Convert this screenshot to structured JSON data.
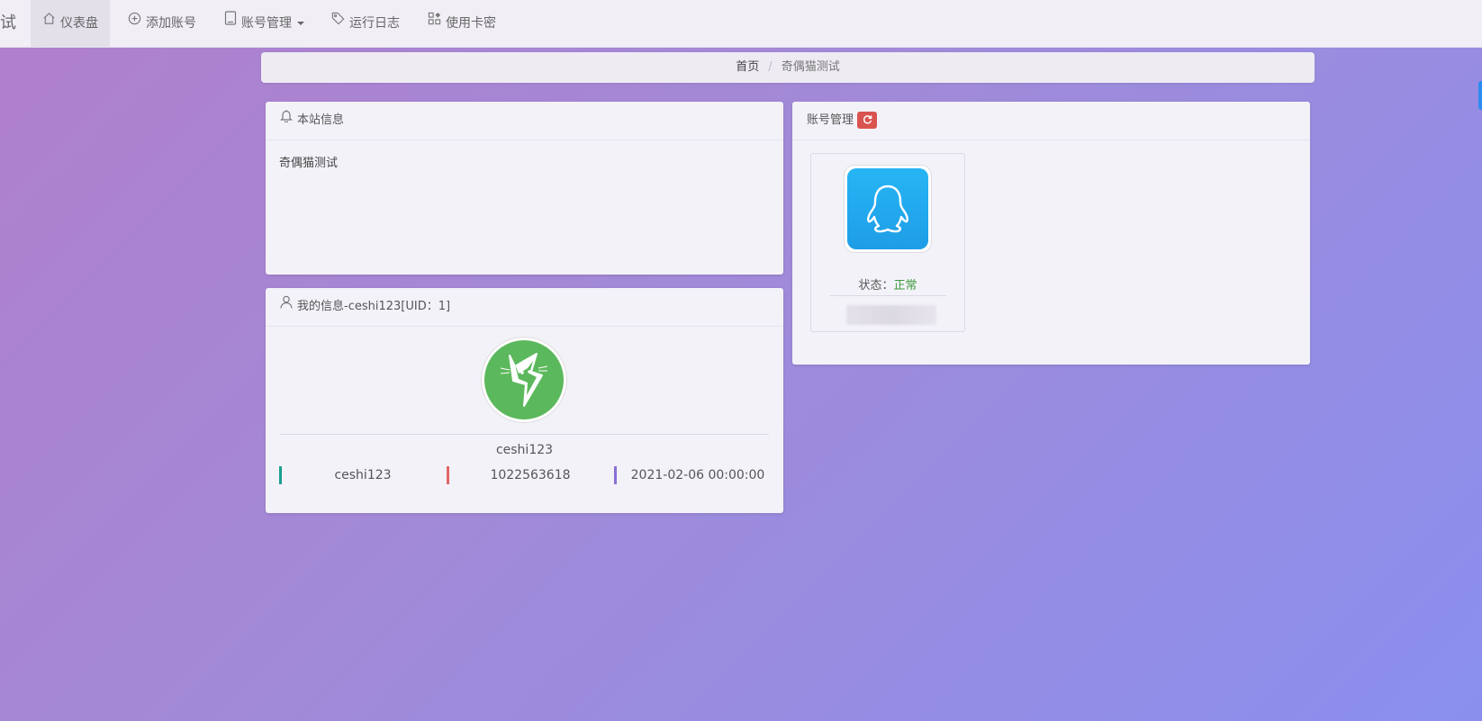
{
  "navbar": {
    "brand_tail": "试",
    "items": [
      {
        "label": "仪表盘",
        "icon": "home-icon",
        "active": true
      },
      {
        "label": "添加账号",
        "icon": "plus-circle-icon"
      },
      {
        "label": "账号管理",
        "icon": "book-icon",
        "dropdown": true
      },
      {
        "label": "运行日志",
        "icon": "tag-icon"
      },
      {
        "label": "使用卡密",
        "icon": "apps-icon"
      }
    ]
  },
  "breadcrumb": {
    "home": "首页",
    "separator": "/",
    "current": "奇偶猫测试"
  },
  "site_info": {
    "title": "本站信息",
    "content": "奇偶猫测试"
  },
  "my_info": {
    "title": "我的信息-ceshi123[UID：1]",
    "username": "ceshi123",
    "stats": [
      {
        "value": "ceshi123",
        "color": "#1a9e8f"
      },
      {
        "value": "1022563618",
        "color": "#e06666"
      },
      {
        "value": "2021-02-06 00:00:00",
        "color": "#8a6fd6"
      }
    ]
  },
  "accounts": {
    "title": "账号管理",
    "badge_color": "#d9534f",
    "card": {
      "status_label": "状态：",
      "status_value": "正常",
      "status_color": "#3c9a3c"
    }
  }
}
